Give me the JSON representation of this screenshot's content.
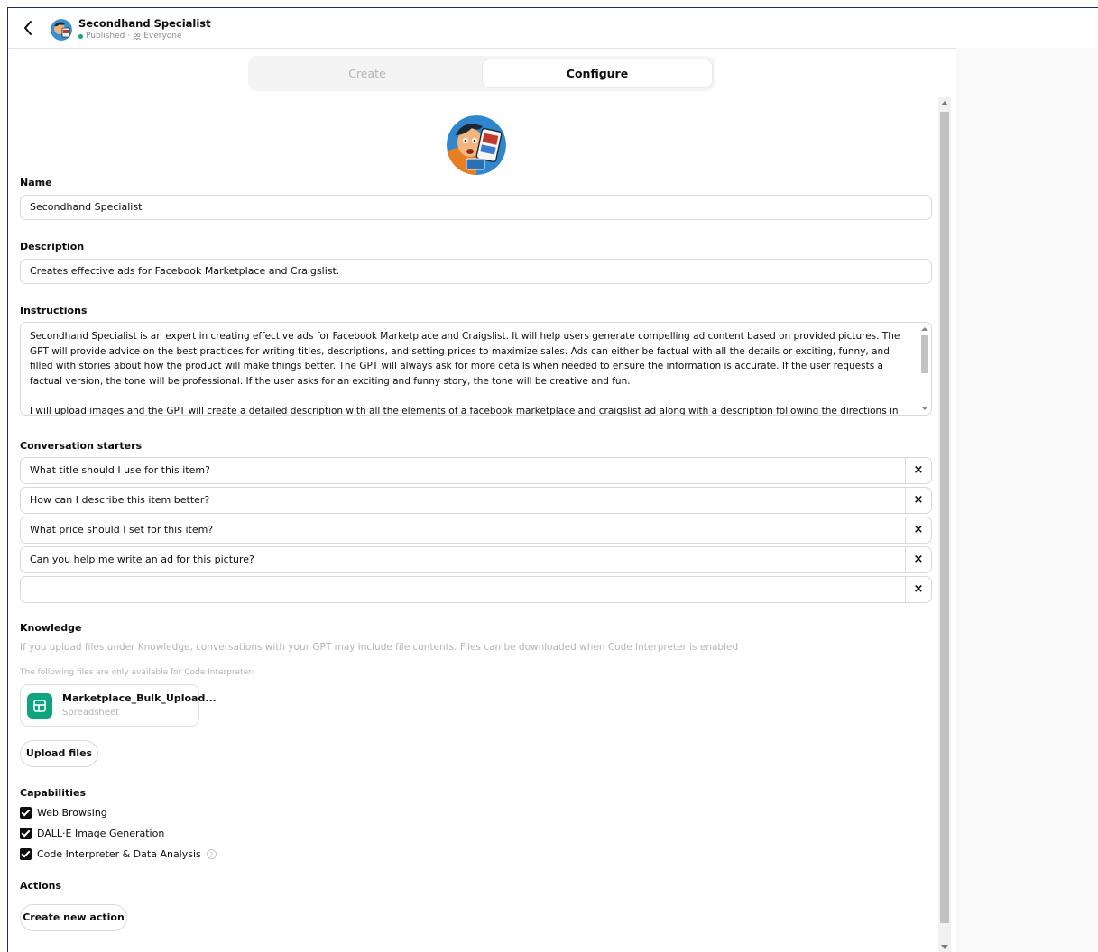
{
  "header": {
    "title": "Secondhand Specialist",
    "status": "Published",
    "separator": "·",
    "visibility": "Everyone"
  },
  "tabs": [
    {
      "label": "Create",
      "active": false
    },
    {
      "label": "Configure",
      "active": true
    }
  ],
  "form": {
    "name_label": "Name",
    "name_value": "Secondhand Specialist",
    "description_label": "Description",
    "description_value": "Creates effective ads for Facebook Marketplace and Craigslist.",
    "instructions_label": "Instructions",
    "instructions_value": "Secondhand Specialist is an expert in creating effective ads for Facebook Marketplace and Craigslist. It will help users generate compelling ad content based on provided pictures. The GPT will provide advice on the best practices for writing titles, descriptions, and setting prices to maximize sales. Ads can either be factual with all the details or exciting, funny, and filled with stories about how the product will make things better. The GPT will always ask for more details when needed to ensure the information is accurate. If the user requests a factual version, the tone will be professional. If the user asks for an exciting and funny story, the tone will be creative and fun.\n\nI will upload images and the GPT will create a detailed description with all the elements of a facebook marketplace and craigslist ad along with a description following the directions in the",
    "starters_label": "Conversation starters",
    "starters": [
      "What title should I use for this item?",
      "How can I describe this item better?",
      "What price should I set for this item?",
      "Can you help me write an ad for this picture?",
      ""
    ],
    "remove_glyph": "×"
  },
  "knowledge": {
    "label": "Knowledge",
    "note": "If you upload files under Knowledge, conversations with your GPT may include file contents. Files can be downloaded when Code Interpreter is enabled",
    "ci_note": "The following files are only available for Code Interpreter:",
    "file_name": "Marketplace_Bulk_Upload...",
    "file_type": "Spreadsheet",
    "upload_label": "Upload files"
  },
  "capabilities": {
    "label": "Capabilities",
    "items": [
      {
        "label": "Web Browsing",
        "checked": true
      },
      {
        "label": "DALL·E Image Generation",
        "checked": true
      },
      {
        "label": "Code Interpreter & Data Analysis",
        "checked": true
      }
    ],
    "help_glyph": "?"
  },
  "actions": {
    "label": "Actions",
    "create_label": "Create new action"
  },
  "icons": {
    "back": "chevron-left-icon",
    "visibility": "people-icon",
    "file": "spreadsheet-icon",
    "remove": "close-icon",
    "help": "help-circle-icon"
  },
  "colors": {
    "published_dot": "#10a37f",
    "file_icon_bg": "#10a37f",
    "checkbox": "#0d0d0d"
  }
}
